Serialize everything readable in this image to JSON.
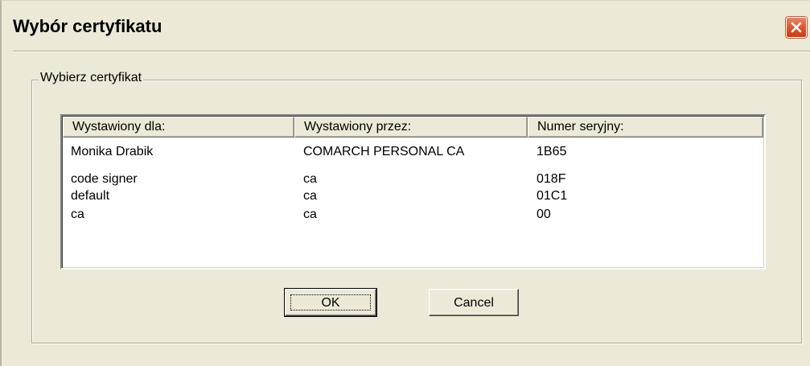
{
  "window": {
    "title": "Wybór certyfikatu",
    "close_icon": "close-icon"
  },
  "group": {
    "legend": "Wybierz certyfikat"
  },
  "table": {
    "columns": [
      "Wystawiony dla:",
      "Wystawiony przez:",
      "Numer seryjny:"
    ],
    "rows": [
      [
        "Monika Drabik",
        "COMARCH PERSONAL CA",
        "1B65"
      ],
      [
        "code signer",
        "ca",
        "018F"
      ],
      [
        "default",
        "ca",
        "01C1"
      ],
      [
        "ca",
        "ca",
        "00"
      ]
    ]
  },
  "buttons": {
    "ok": "OK",
    "cancel": "Cancel"
  },
  "colors": {
    "dialog_background": "#ece9d8",
    "close_button": "#d9532b"
  }
}
